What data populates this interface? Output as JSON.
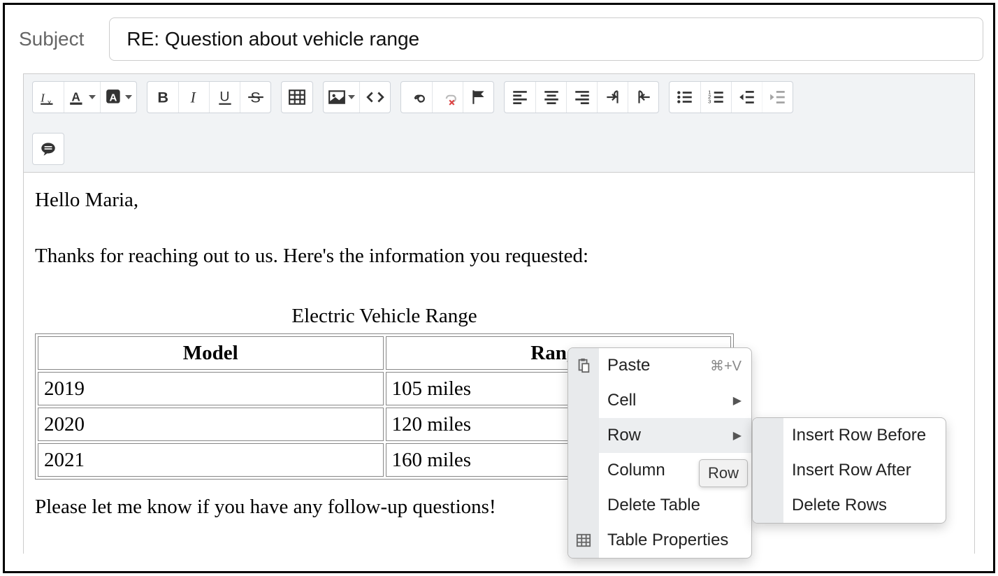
{
  "subject": {
    "label": "Subject",
    "value": "RE: Question about vehicle range"
  },
  "body": {
    "greeting": "Hello Maria,",
    "intro": "Thanks for reaching out to us. Here's the information you requested:",
    "closing": "Please let me know if you have any follow-up questions!",
    "table": {
      "caption": "Electric Vehicle Range",
      "headers": [
        "Model",
        "Range"
      ],
      "rows": [
        [
          "2019",
          "105 miles"
        ],
        [
          "2020",
          "120 miles"
        ],
        [
          "2021",
          "160 miles"
        ]
      ]
    }
  },
  "context_menu": {
    "paste": "Paste",
    "paste_shortcut": "⌘+V",
    "cell": "Cell",
    "row": "Row",
    "column": "Column",
    "delete_table": "Delete Table",
    "table_properties": "Table Properties"
  },
  "tooltip": "Row",
  "submenu": {
    "insert_before": "Insert Row Before",
    "insert_after": "Insert Row After",
    "delete_rows": "Delete Rows"
  }
}
